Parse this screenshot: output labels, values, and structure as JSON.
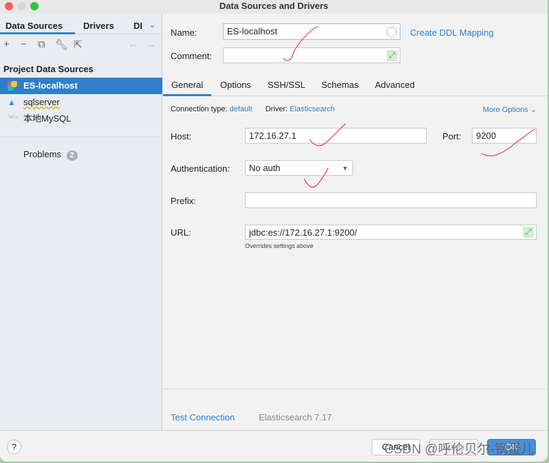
{
  "window": {
    "title": "Data Sources and Drivers"
  },
  "left": {
    "tabs": [
      "Data Sources",
      "Drivers",
      "DI"
    ],
    "section": "Project Data Sources",
    "items": [
      {
        "label": "ES-localhost"
      },
      {
        "label": "sqlserver"
      },
      {
        "label": "本地MySQL"
      }
    ],
    "problems": {
      "label": "Problems",
      "count": "2"
    }
  },
  "form": {
    "name_label": "Name:",
    "name_value": "ES-localhost",
    "create_ddl": "Create DDL Mapping",
    "comment_label": "Comment:",
    "comment_value": "",
    "tabs": [
      "General",
      "Options",
      "SSH/SSL",
      "Schemas",
      "Advanced"
    ],
    "conn_type_label": "Connection type:",
    "conn_type_value": "default",
    "driver_label": "Driver:",
    "driver_value": "Elasticsearch",
    "more_options": "More Options",
    "host_label": "Host:",
    "host_value": "172.16.27.1",
    "port_label": "Port:",
    "port_value": "9200",
    "auth_label": "Authentication:",
    "auth_value": "No auth",
    "prefix_label": "Prefix:",
    "prefix_value": "",
    "url_label": "URL:",
    "url_value": "jdbc:es://172.16.27.1:9200/",
    "url_hint": "Overrides settings above",
    "test_connection": "Test Connection",
    "driver_version": "Elasticsearch 7.17"
  },
  "footer": {
    "help": "?",
    "cancel": "Cancel",
    "apply": "Apply",
    "ok": "OK"
  },
  "watermark": "CSDN @呼伦贝尔-钢蛋儿",
  "colors": {
    "accent": "#2f7fcb",
    "annotation": "#e0201c"
  }
}
